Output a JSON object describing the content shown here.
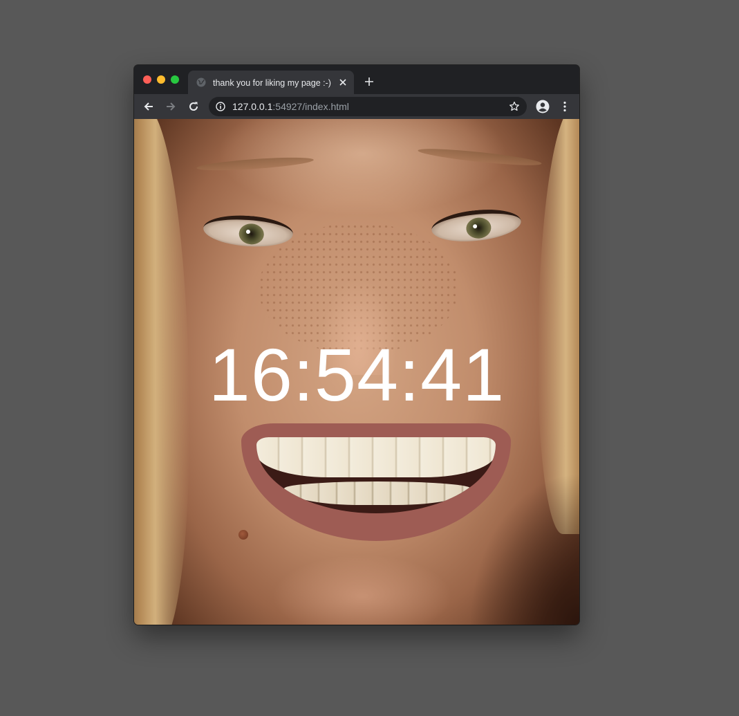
{
  "browser": {
    "tab": {
      "title": "thank you for liking my page :-)",
      "favicon": "globe-icon"
    },
    "toolbar": {
      "back": "arrow-left-icon",
      "forward": "arrow-right-icon",
      "reload": "reload-icon",
      "url_host": "127.0.0.1",
      "url_rest": ":54927/index.html",
      "info": "info-icon",
      "bookmark": "star-icon",
      "profile": "account-icon",
      "menu": "more-vertical-icon"
    },
    "colors": {
      "frame": "#202124",
      "toolbar": "#35363a",
      "desktop": "#585858"
    }
  },
  "page": {
    "clock": "16:54:41",
    "background": "smiling face photo"
  }
}
